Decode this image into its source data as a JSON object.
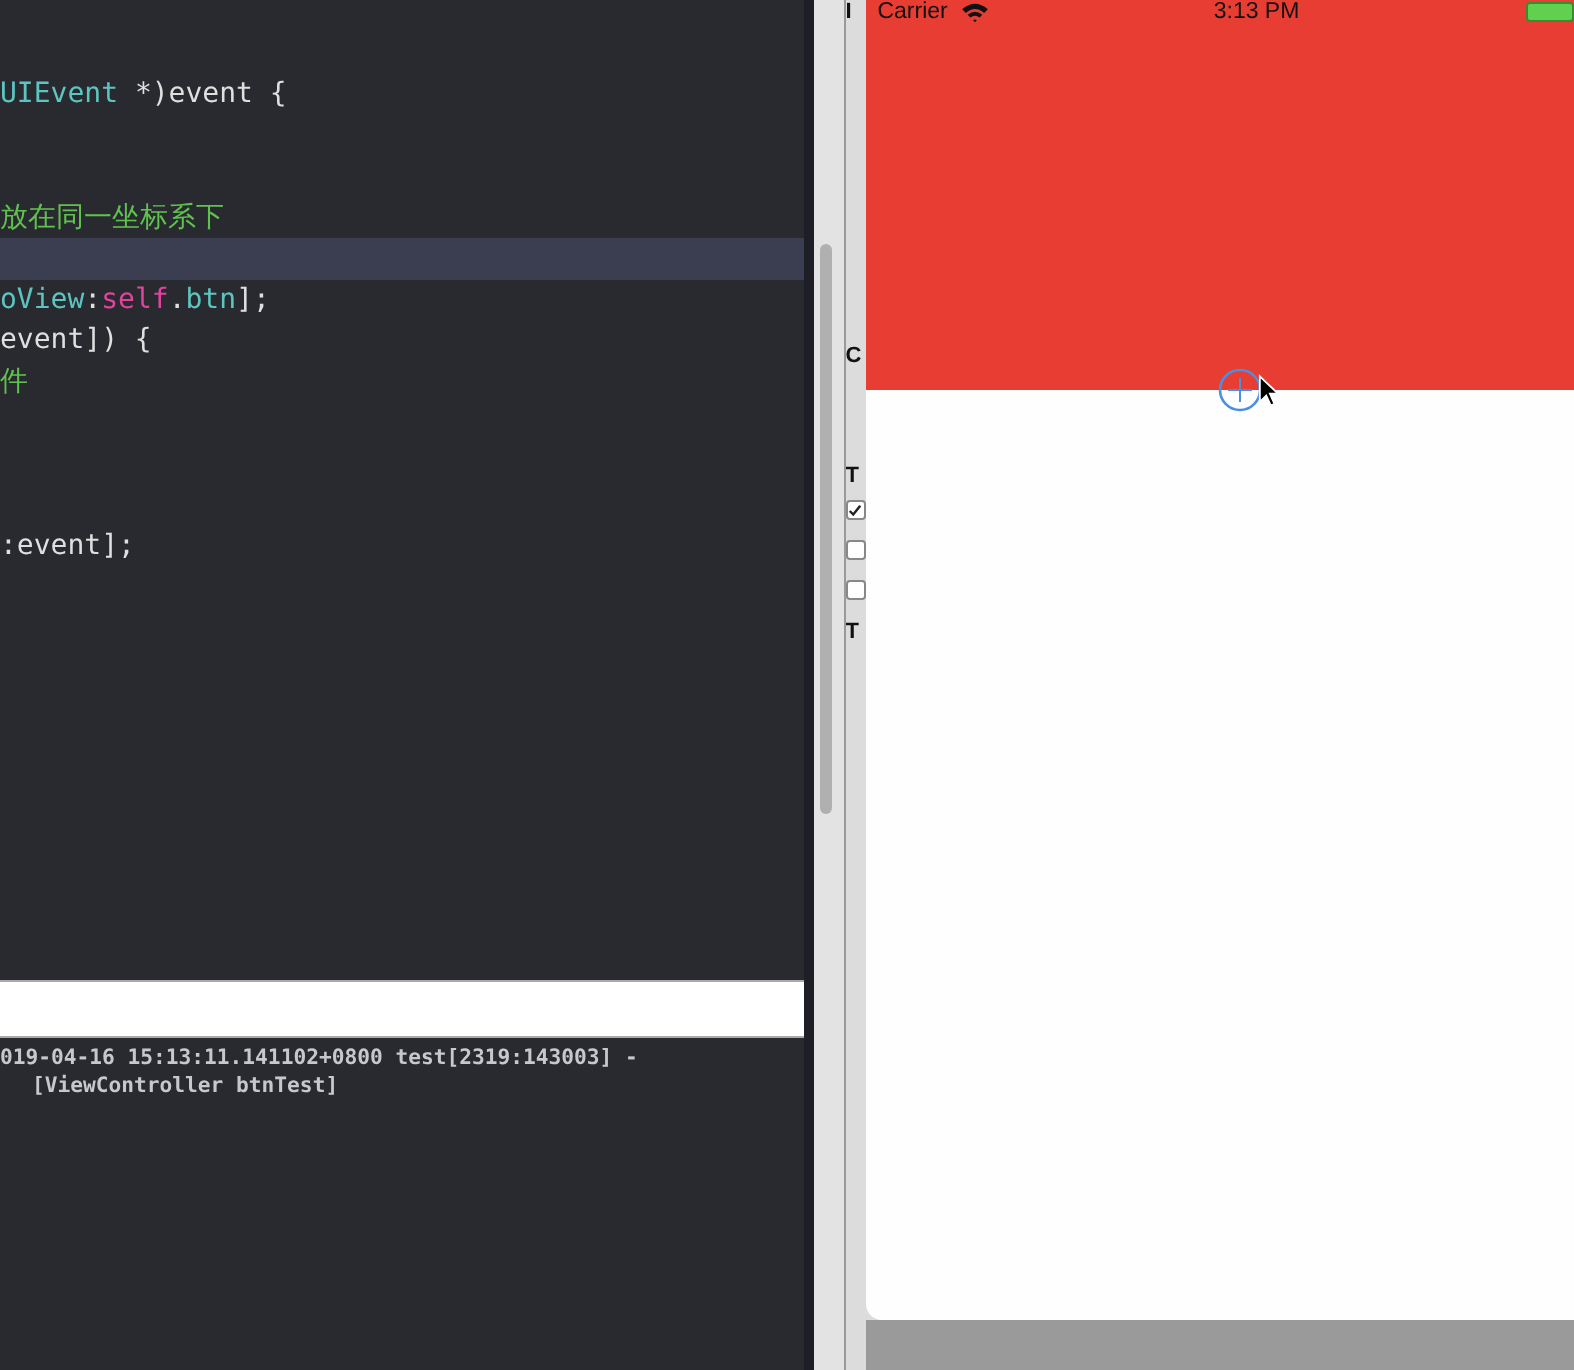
{
  "editor": {
    "lines": [
      {
        "highlighted": false,
        "tokens": [
          {
            "kind": "type",
            "text": "UIEvent"
          },
          {
            "kind": "plain",
            "text": " *)event {"
          }
        ]
      },
      {
        "highlighted": false
      },
      {
        "highlighted": false
      },
      {
        "highlighted": false,
        "tokens": [
          {
            "kind": "comment",
            "text": "放在同一坐标系下"
          }
        ]
      },
      {
        "highlighted": true
      },
      {
        "highlighted": false,
        "tokens": [
          {
            "kind": "type",
            "text": "oView"
          },
          {
            "kind": "plain",
            "text": ":"
          },
          {
            "kind": "keyword",
            "text": "self"
          },
          {
            "kind": "plain",
            "text": "."
          },
          {
            "kind": "type",
            "text": "btn"
          },
          {
            "kind": "plain",
            "text": "];"
          }
        ]
      },
      {
        "highlighted": false,
        "tokens": [
          {
            "kind": "plain",
            "text": "event]) {"
          }
        ]
      },
      {
        "highlighted": false,
        "tokens": [
          {
            "kind": "comment",
            "text": "件"
          }
        ]
      },
      {
        "highlighted": false
      },
      {
        "highlighted": false
      },
      {
        "highlighted": false
      },
      {
        "highlighted": false,
        "tokens": [
          {
            "kind": "plain",
            "text": ":event];"
          }
        ]
      }
    ]
  },
  "console": {
    "lines": [
      "019-04-16 15:13:11.141102+0800 test[2319:143003] -",
      "[ViewController btnTest]"
    ]
  },
  "inspector": {
    "items": [
      {
        "kind": "label",
        "text": "I"
      },
      {
        "kind": "label",
        "text": "C"
      },
      {
        "kind": "label",
        "text": "T"
      },
      {
        "kind": "checkbox",
        "checked": true
      },
      {
        "kind": "checkbox",
        "checked": false
      },
      {
        "kind": "checkbox",
        "checked": false
      },
      {
        "kind": "label",
        "text": "T"
      }
    ]
  },
  "simulator": {
    "carrier": "Carrier",
    "time": "3:13 PM"
  }
}
